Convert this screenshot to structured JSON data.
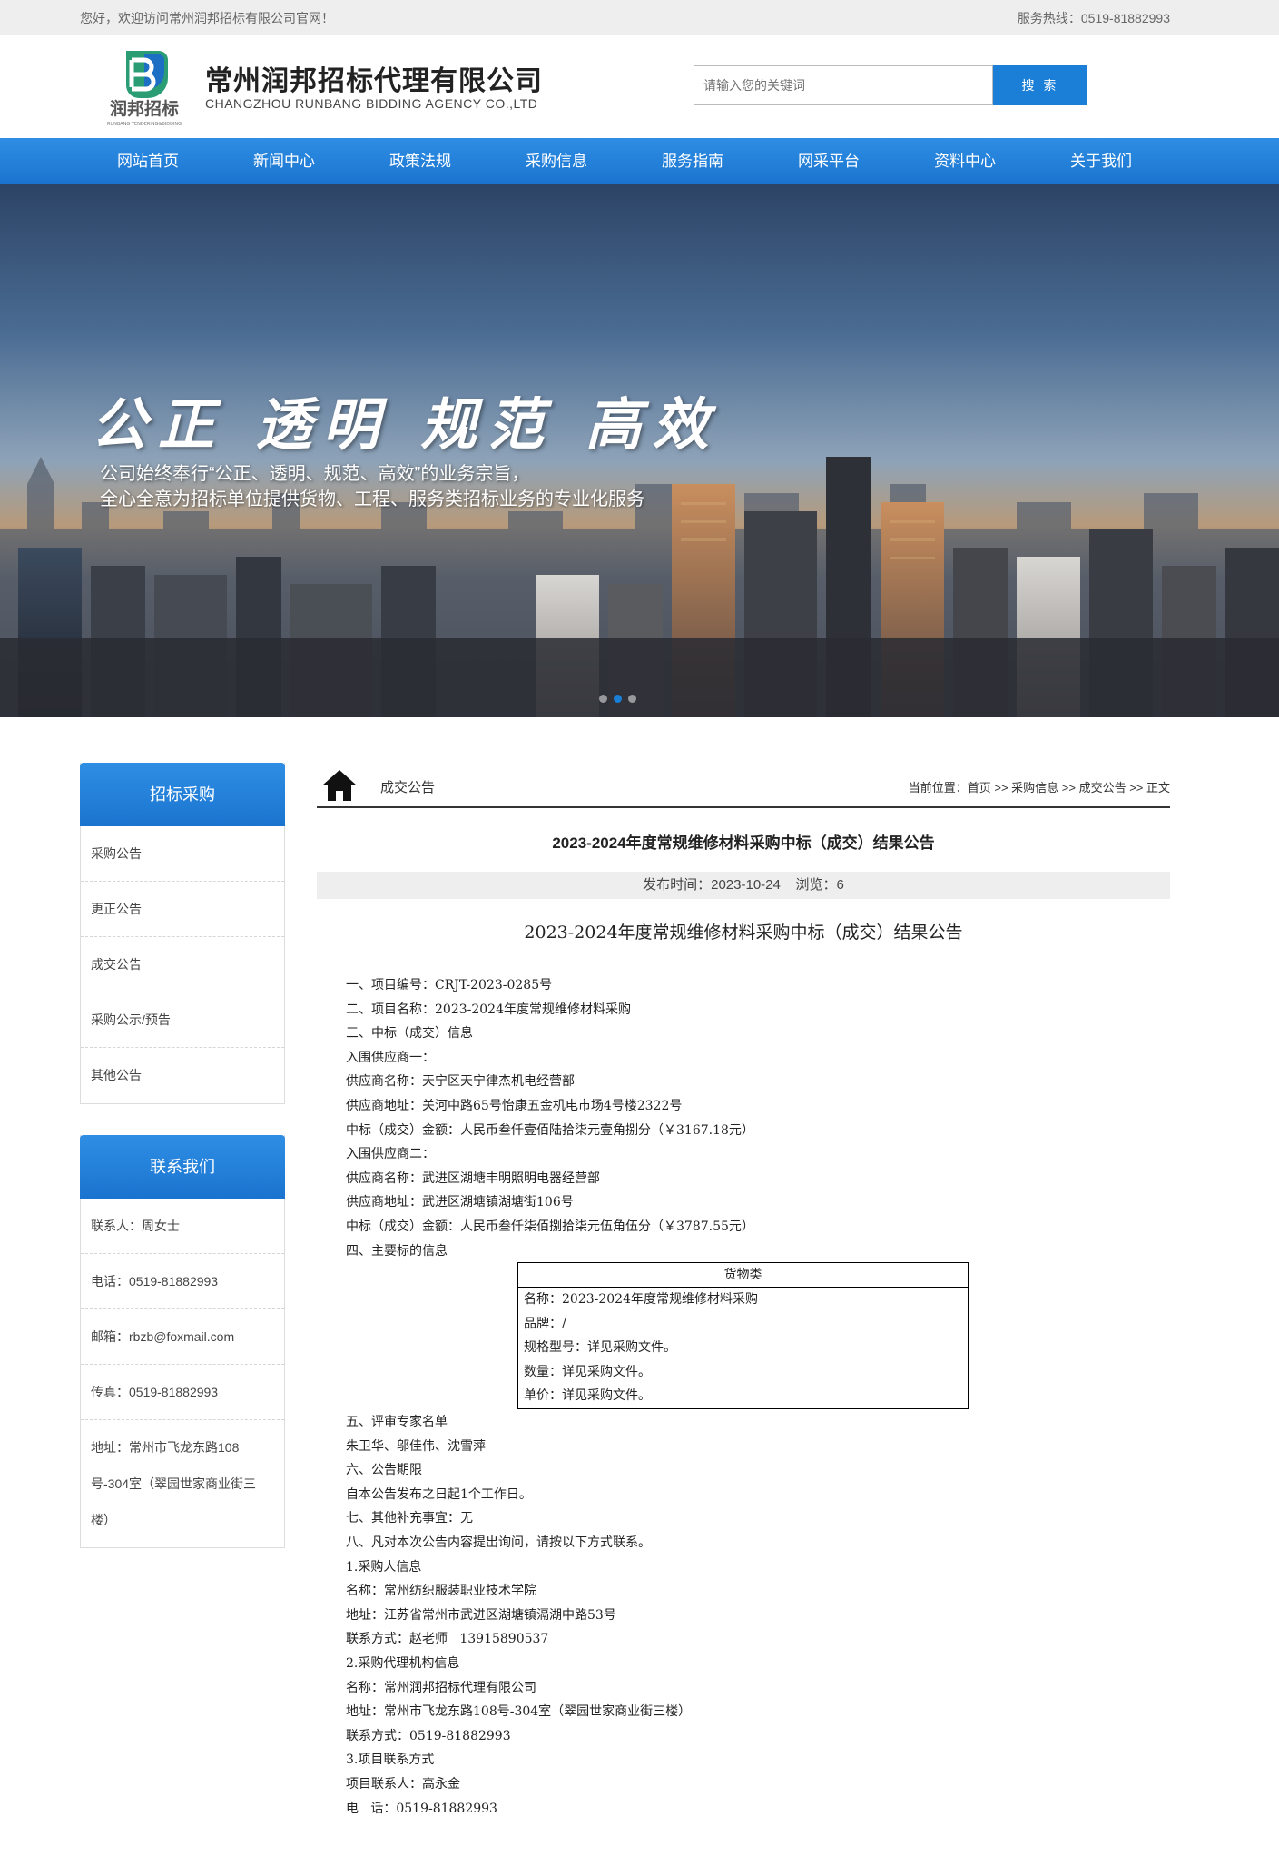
{
  "topbar": {
    "welcome": "您好，欢迎访问常州润邦招标有限公司官网！",
    "hotline": "服务热线：0519-81882993"
  },
  "header": {
    "logo_text": "润邦招标",
    "logo_sub": "RUNBANG TENDERING&BIDDING",
    "company_cn": "常州润邦招标代理有限公司",
    "company_en": "CHANGZHOU RUNBANG BIDDING AGENCY CO.,LTD",
    "search_placeholder": "请输入您的关键词",
    "search_button": "搜 索"
  },
  "nav": [
    "网站首页",
    "新闻中心",
    "政策法规",
    "采购信息",
    "服务指南",
    "网采平台",
    "资料中心",
    "关于我们"
  ],
  "banner": {
    "slogan": "公正 透明 规范 高效",
    "line1": "公司始终奉行“公正、透明、规范、高效”的业务宗旨，",
    "line2": "全心全意为招标单位提供货物、工程、服务类招标业务的专业化服务"
  },
  "sidebar": {
    "procurement": {
      "title": "招标采购",
      "items": [
        "采购公告",
        "更正公告",
        "成交公告",
        "采购公示/预告",
        "其他公告"
      ]
    },
    "contact": {
      "title": "联系我们",
      "items": [
        "联系人：周女士",
        "电话：0519-81882993",
        "邮箱：rbzb@foxmail.com",
        "传真：0519-81882993"
      ],
      "address": [
        "地址：常州市飞龙东路108",
        "号-304室（翠园世家商业街三",
        "楼）"
      ]
    }
  },
  "breadcrumb": {
    "section": "成交公告",
    "path": "当前位置：首页 >> 采购信息 >> 成交公告 >> 正文"
  },
  "article": {
    "title": "2023-2024年度常规维修材料采购中标（成交）结果公告",
    "meta": "发布时间：2023-10-24    浏览：6",
    "content_title": "2023-2024年度常规维修材料采购中标（成交）结果公告",
    "lines_a": [
      "一、项目编号：CRJT-2023-0285号",
      "二、项目名称：2023-2024年度常规维修材料采购",
      "三、中标（成交）信息",
      "入围供应商一：",
      "供应商名称：天宁区天宁律杰机电经营部",
      "供应商地址：关河中路65号怡康五金机电市场4号楼2322号",
      "中标（成交）金额：人民币叁仟壹佰陆拾柒元壹角捌分（￥3167.18元）",
      "入围供应商二：",
      "供应商名称：武进区湖塘丰明照明电器经营部",
      "供应商地址：武进区湖塘镇湖塘街106号",
      "中标（成交）金额：人民币叁仟柒佰捌拾柒元伍角伍分（￥3787.55元）",
      "四、主要标的信息"
    ],
    "goods": {
      "header": "货物类",
      "rows": [
        "名称：2023-2024年度常规维修材料采购",
        "品牌：/",
        "规格型号：详见采购文件。",
        "数量：详见采购文件。",
        "单价：详见采购文件。"
      ]
    },
    "lines_b": [
      "五、评审专家名单",
      "朱卫华、邬佳伟、沈雪萍",
      "六、公告期限",
      "自本公告发布之日起1个工作日。",
      "七、其他补充事宜：无",
      "八、凡对本次公告内容提出询问，请按以下方式联系。",
      "1.采购人信息",
      "名称：常州纺织服装职业技术学院",
      "地址：江苏省常州市武进区湖塘镇滆湖中路53号",
      "联系方式：赵老师   13915890537",
      "2.采购代理机构信息",
      "名称：常州润邦招标代理有限公司",
      "地址：常州市飞龙东路108号-304室（翠园世家商业街三楼）",
      "联系方式：0519-81882993",
      "3.项目联系方式",
      "项目联系人：高永金",
      "电   话：0519-81882993"
    ]
  }
}
